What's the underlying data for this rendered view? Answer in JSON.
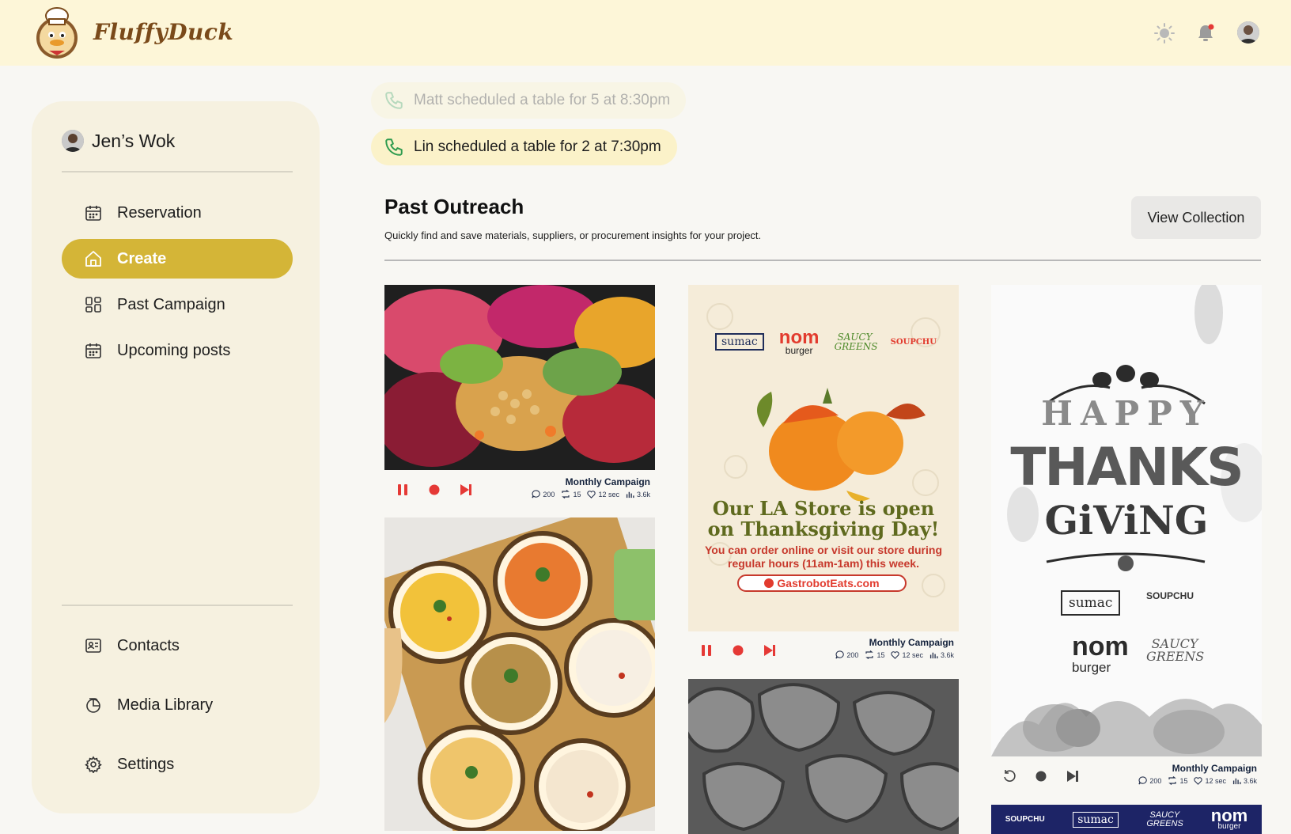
{
  "brand": {
    "name": "FluffyDuck"
  },
  "header": {
    "icons": [
      "sun-icon",
      "bell-icon",
      "user-avatar"
    ],
    "accent": "#d4b537"
  },
  "sidebar": {
    "business_name": "Jen’s Wok",
    "nav": [
      {
        "label": "Reservation",
        "icon": "calendar-icon"
      },
      {
        "label": "Create",
        "icon": "home-icon",
        "active": true
      },
      {
        "label": "Past Campaign",
        "icon": "grid-icon"
      },
      {
        "label": "Upcoming posts",
        "icon": "calendar-icon"
      }
    ],
    "bottom_nav": [
      {
        "label": "Contacts",
        "icon": "contact-card-icon"
      },
      {
        "label": "Media Library",
        "icon": "media-icon"
      },
      {
        "label": "Settings",
        "icon": "gear-icon"
      }
    ]
  },
  "notifications": [
    {
      "text": "Matt scheduled a table for 5 at 8:30pm",
      "faded": true
    },
    {
      "text": "Lin scheduled a table for 2 at 7:30pm",
      "faded": false
    }
  ],
  "outreach": {
    "title": "Past Outreach",
    "subtitle": "Quickly find and save materials, suppliers, or procurement insights for your project.",
    "view_button": "View Collection",
    "cards": [
      {
        "campaign": "Monthly Campaign",
        "comments": "200",
        "reposts": "15",
        "likes": "12 sec",
        "views": "3.6k"
      },
      {
        "campaign": "Monthly Campaign",
        "comments": "200",
        "reposts": "15",
        "likes": "12 sec",
        "views": "3.6k"
      },
      {
        "campaign": "Monthly Campaign",
        "comments": "200",
        "reposts": "15",
        "likes": "12 sec",
        "views": "3.6k"
      }
    ]
  },
  "posters": {
    "thanksgiving_la": {
      "brands": [
        "sumac",
        "nom",
        "burger",
        "SAUCY GREENS",
        "SOUPCHU"
      ],
      "headline_1": "Our LA Store is open",
      "headline_2": "on Thanksgiving Day!",
      "body_1": "You can order online or visit our store during",
      "body_2": "regular hours (11am-1am) this week.",
      "url": "GastrobotEats.com"
    },
    "happy_thanksgiving": {
      "line_1": "HAPPY",
      "line_2": "THANKS",
      "line_3": "GiViNG",
      "brands": [
        "sumac",
        "SOUPCHU",
        "nom",
        "burger",
        "SAUCY GREENS"
      ]
    },
    "bottom_strip": {
      "brands": [
        "SOUPCHU",
        "sumac",
        "SAUCY GREENS",
        "nom",
        "burger"
      ]
    }
  }
}
